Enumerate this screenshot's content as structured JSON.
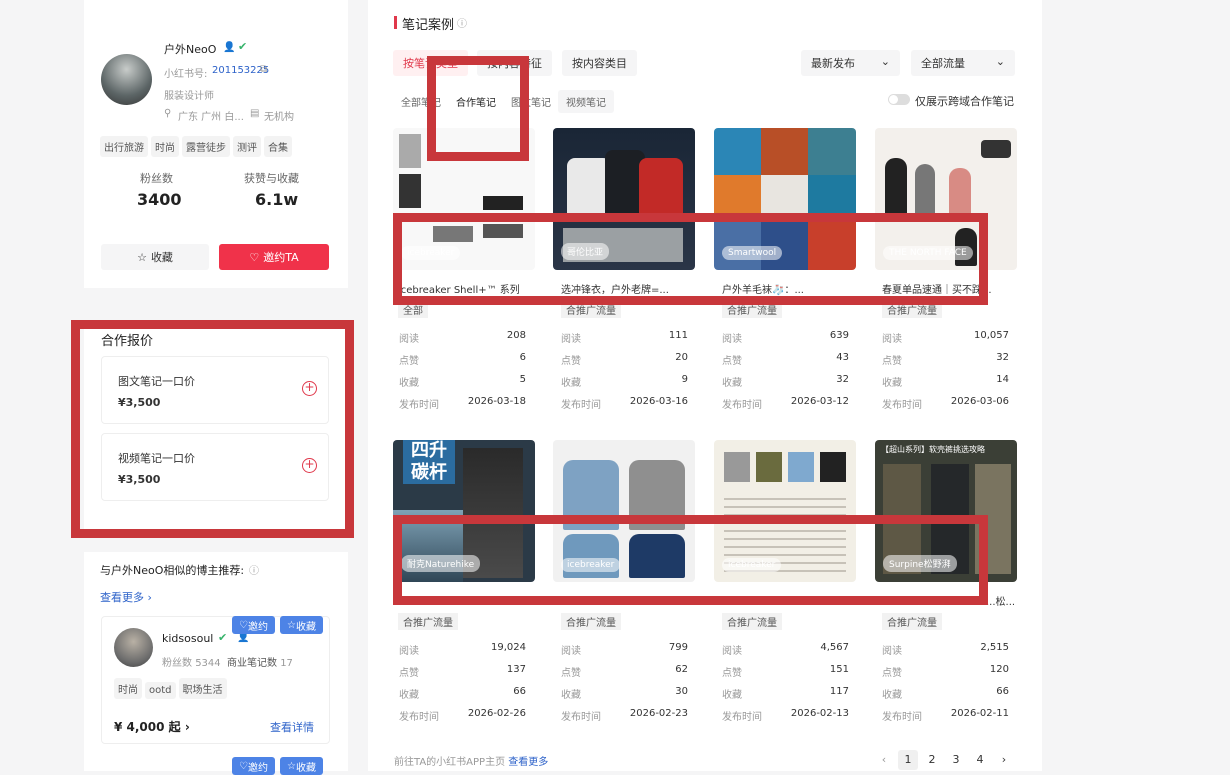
{
  "profile": {
    "name": "户外NeoO",
    "id_label": "小红书号:",
    "id_value": "201153225",
    "role": "服装设计师",
    "location": "广东 广州 白...",
    "org": "无机构",
    "tags": [
      "出行旅游",
      "时尚",
      "露营徒步",
      "测评",
      "合集"
    ],
    "fans_label": "粉丝数",
    "fans_value": "3400",
    "likes_label": "获赞与收藏",
    "likes_value": "6.1w",
    "collect_btn": "收藏",
    "invite_btn": "邀约TA"
  },
  "quote": {
    "title": "合作报价",
    "items": [
      {
        "label": "图文笔记一口价",
        "price": "¥3,500"
      },
      {
        "label": "视频笔记一口价",
        "price": "¥3,500"
      }
    ]
  },
  "similar": {
    "title": "与户外NeoO相似的博主推荐:",
    "more": "查看更多",
    "blogger": {
      "name": "kidsosoul",
      "fans_label": "粉丝数",
      "fans_value": "5344",
      "notes_label": "商业笔记数",
      "notes_value": "17",
      "tags": [
        "时尚",
        "ootd",
        "职场生活"
      ],
      "price": "¥ 4,000 起",
      "detail": "查看详情",
      "invite": "邀约",
      "collect": "收藏"
    }
  },
  "notes": {
    "title": "笔记案例",
    "filter_btns": [
      "按笔记类型",
      "按内容特征",
      "按内容类目"
    ],
    "sort": "最新发布",
    "traffic": "全部流量",
    "subtabs": [
      "全部笔记",
      "合作笔记",
      "图文笔记",
      "视频笔记"
    ],
    "toggle_label": "仅展示跨域合作笔记",
    "stat_labels": [
      "阅读",
      "点赞",
      "收藏",
      "发布时间"
    ],
    "row1": [
      {
        "title": "icebreaker Shell+™ 系列",
        "brand": "icebreaker",
        "tag": "全部",
        "read": "208",
        "like": "6",
        "fav": "5",
        "date": "2026-03-18"
      },
      {
        "title": "选冲锋衣，户外老牌=...",
        "brand": "哥伦比亚",
        "tag": "合推广流量",
        "read": "111",
        "like": "20",
        "fav": "9",
        "date": "2026-03-16"
      },
      {
        "title": "户外羊毛袜🧦：...",
        "brand": "Smartwool",
        "tag": "合推广流量",
        "read": "639",
        "like": "43",
        "fav": "32",
        "date": "2026-03-12"
      },
      {
        "title": "春夏单品速通｜买不踩...",
        "brand": "THE NORTH FACE",
        "tag": "合推广流量",
        "read": "10,057",
        "like": "32",
        "fav": "14",
        "date": "2026-03-06"
      }
    ],
    "row2": [
      {
        "title": "",
        "brand": "耐克Naturehike",
        "tag": "合推广流量",
        "read": "19,024",
        "like": "137",
        "fav": "66",
        "date": "2026-02-26"
      },
      {
        "title": "",
        "brand": "icebreaker",
        "tag": "合推广流量",
        "read": "799",
        "like": "62",
        "fav": "30",
        "date": "2026-02-23"
      },
      {
        "title": "",
        "brand": "icebreaker",
        "tag": "合推广流量",
        "read": "4,567",
        "like": "151",
        "fav": "117",
        "date": "2026-02-13"
      },
      {
        "title": "...松...",
        "brand": "Surpine松野湃",
        "tag": "合推广流量",
        "read": "2,515",
        "like": "120",
        "fav": "66",
        "date": "2026-02-11"
      }
    ],
    "thumb_text": {
      "carbon_top": "四升",
      "carbon": "碳杆",
      "north_top": "【超山系列】软壳裤挑选攻略"
    },
    "footer_link_prefix": "前往TA的小红书APP主页",
    "footer_link": "查看更多",
    "pages": [
      "1",
      "2",
      "3",
      "4"
    ]
  }
}
